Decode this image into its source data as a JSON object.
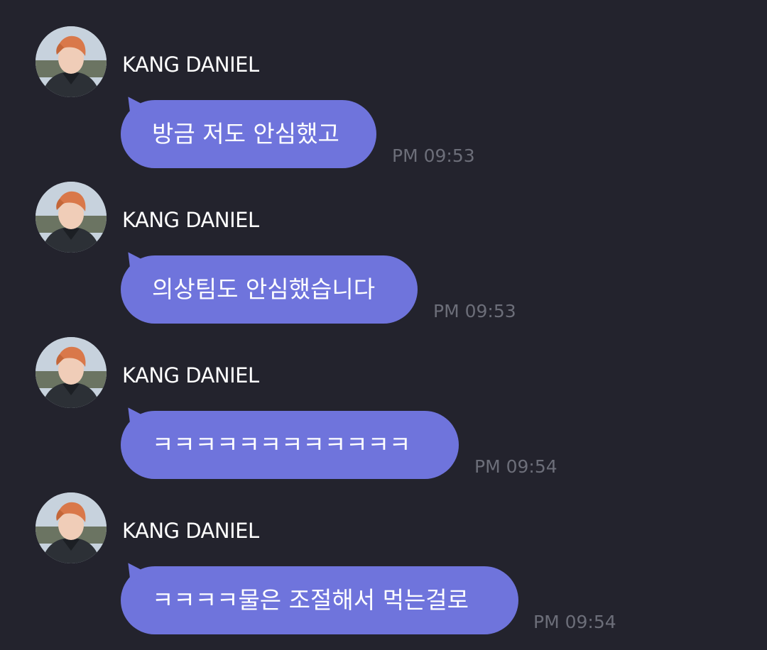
{
  "chat": {
    "messages": [
      {
        "sender": "KANG DANIEL",
        "text": "방금 저도 안심했고",
        "time": "PM 09:53"
      },
      {
        "sender": "KANG DANIEL",
        "text": "의상팀도 안심했습니다",
        "time": "PM 09:53"
      },
      {
        "sender": "KANG DANIEL",
        "text": "ㅋㅋㅋㅋㅋㅋㅋㅋㅋㅋㅋㅋ",
        "time": "PM 09:54"
      },
      {
        "sender": "KANG DANIEL",
        "text": "ㅋㅋㅋㅋ물은 조절해서 먹는걸로",
        "time": "PM 09:54"
      }
    ]
  },
  "colors": {
    "background": "#23232d",
    "bubble": "#6f74dc",
    "sender_text": "#ffffff",
    "time_text": "#6c6e79"
  },
  "icons": {
    "avatar": "profile-photo"
  }
}
